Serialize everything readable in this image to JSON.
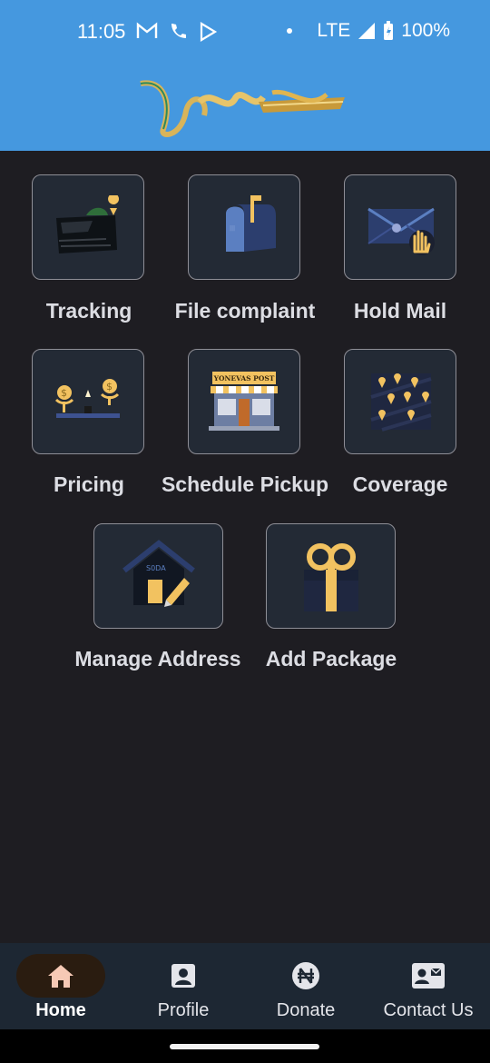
{
  "status_bar": {
    "time": "11:05",
    "network": "LTE",
    "battery": "100%",
    "icons": [
      "gmail-icon",
      "phone-icon",
      "play-icon",
      "dot-icon",
      "signal-icon",
      "battery-icon"
    ]
  },
  "header": {
    "logo_alt": "YONEVAS POST"
  },
  "grid": [
    {
      "label": "Tracking",
      "icon": "tracking-map-icon"
    },
    {
      "label": "File complaint",
      "icon": "mailbox-icon"
    },
    {
      "label": "Hold Mail",
      "icon": "envelope-hand-icon"
    },
    {
      "label": "Pricing",
      "icon": "pricing-coins-icon"
    },
    {
      "label": "Schedule Pickup",
      "icon": "post-office-store-icon",
      "store_sign": "YONEVAS POST"
    },
    {
      "label": "Coverage",
      "icon": "coverage-pins-icon"
    },
    {
      "label": "Manage Address",
      "icon": "house-pencil-icon"
    },
    {
      "label": "Add Package",
      "icon": "gift-package-icon"
    }
  ],
  "bottom_nav": {
    "items": [
      {
        "label": "Home",
        "icon": "home-icon",
        "active": true
      },
      {
        "label": "Profile",
        "icon": "profile-icon",
        "active": false
      },
      {
        "label": "Donate",
        "icon": "naira-icon",
        "active": false
      },
      {
        "label": "Contact Us",
        "icon": "contact-card-icon",
        "active": false
      }
    ]
  },
  "colors": {
    "header_blue": "#4598df",
    "background": "#1e1d22",
    "tile_bg": "#232a35",
    "accent_gold": "#f2c260",
    "nav_bg": "#1d2733",
    "active_pill": "#2a1c10",
    "home_icon": "#f6c9b5"
  }
}
